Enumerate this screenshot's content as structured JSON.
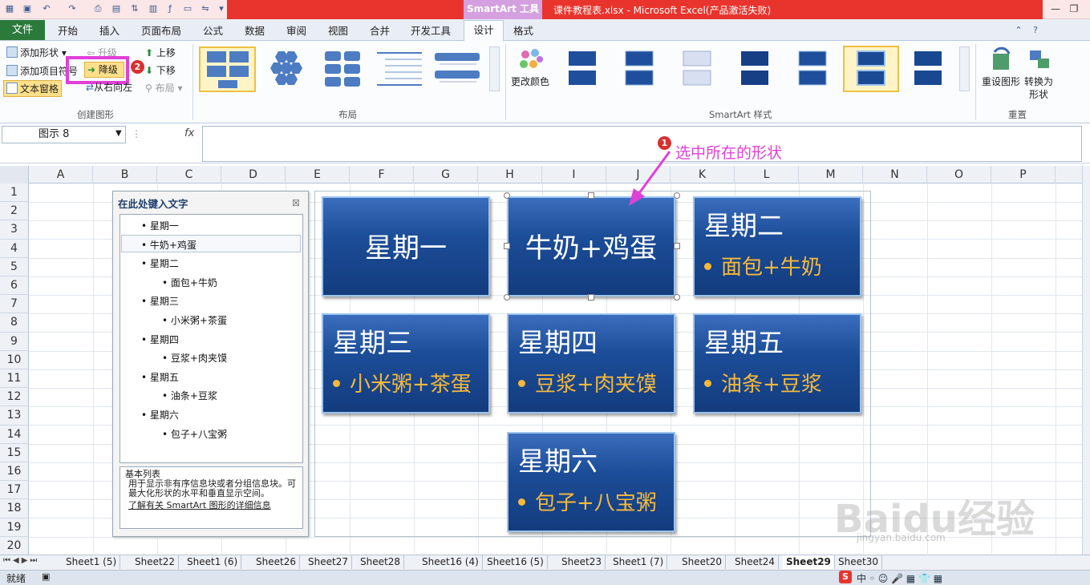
{
  "window": {
    "title": "课件教程表.xlsx - Microsoft Excel(产品激活失败)",
    "contextual_tab_title": "SmartArt 工具"
  },
  "tabs": {
    "file": "文件",
    "items": [
      "开始",
      "插入",
      "页面布局",
      "公式",
      "数据",
      "审阅",
      "视图",
      "合并",
      "开发工具"
    ],
    "design": "设计",
    "format": "格式"
  },
  "ribbon": {
    "create_group": {
      "add_shape": "添加形状",
      "add_bullet": "添加项目符号",
      "text_pane": "文本窗格",
      "promote": "升级",
      "demote": "降级",
      "right_to_left": "从右向左",
      "move_up": "上移",
      "move_down": "下移",
      "layout": "布局",
      "label": "创建图形"
    },
    "layout_group": {
      "label": "布局"
    },
    "styles_group": {
      "change_colors": "更改颜色",
      "label": "SmartArt 样式"
    },
    "reset_group": {
      "reset_graphic": "重设图形",
      "convert": "转换为",
      "convert2": "形状",
      "label": "重置"
    }
  },
  "formula_bar": {
    "name_box": "图示 8",
    "fx": "fx",
    "value": ""
  },
  "grid": {
    "columns": [
      "A",
      "B",
      "C",
      "D",
      "E",
      "F",
      "G",
      "H",
      "I",
      "J",
      "K",
      "L",
      "M",
      "N",
      "O",
      "P"
    ],
    "rows": [
      "1",
      "2",
      "3",
      "4",
      "5",
      "6",
      "7",
      "8",
      "9",
      "10",
      "11",
      "12",
      "13",
      "14",
      "15",
      "16",
      "17",
      "18",
      "19",
      "20"
    ]
  },
  "text_pane": {
    "title": "在此处键入文字",
    "items": [
      {
        "text": "星期一",
        "level": 1
      },
      {
        "text": "牛奶+鸡蛋",
        "level": 1
      },
      {
        "text": "星期二",
        "level": 1
      },
      {
        "text": "面包+牛奶",
        "level": 2
      },
      {
        "text": "星期三",
        "level": 1
      },
      {
        "text": "小米粥+茶蛋",
        "level": 2
      },
      {
        "text": "星期四",
        "level": 1
      },
      {
        "text": "豆浆+肉夹馍",
        "level": 2
      },
      {
        "text": "星期五",
        "level": 1
      },
      {
        "text": "油条+豆浆",
        "level": 2
      },
      {
        "text": "星期六",
        "level": 1
      },
      {
        "text": "包子+八宝粥",
        "level": 2
      }
    ],
    "desc_title": "基本列表",
    "desc_body": "用于显示非有序信息块或者分组信息块。可最大化形状的水平和垂直显示空间。",
    "desc_link": "了解有关 SmartArt 图形的详细信息"
  },
  "smartart": {
    "cards": [
      {
        "title": "星期一",
        "sub": ""
      },
      {
        "title": "牛奶+鸡蛋",
        "sub": ""
      },
      {
        "title": "星期二",
        "sub": "面包+牛奶"
      },
      {
        "title": "星期三",
        "sub": "小米粥+茶蛋"
      },
      {
        "title": "星期四",
        "sub": "豆浆+肉夹馍"
      },
      {
        "title": "星期五",
        "sub": "油条+豆浆"
      },
      {
        "title": "星期六",
        "sub": "包子+八宝粥"
      }
    ]
  },
  "annotations": {
    "step1_number": "1",
    "step1_text": "选中所在的形状",
    "step2_number": "2",
    "color": "#e040d8"
  },
  "sheets": [
    "Sheet1 (5)",
    "Sheet22",
    "Sheet1 (6)",
    "Sheet26",
    "Sheet27",
    "Sheet28",
    "Sheet16 (4)",
    "Sheet16 (5)",
    "Sheet23",
    "Sheet1 (7)",
    "Sheet20",
    "Sheet24",
    "Sheet29",
    "Sheet30"
  ],
  "active_sheet": "Sheet29",
  "status": {
    "ready": "就绪"
  },
  "watermark": {
    "text": "Baidu经验",
    "sub": "jingyan.baidu.com"
  }
}
